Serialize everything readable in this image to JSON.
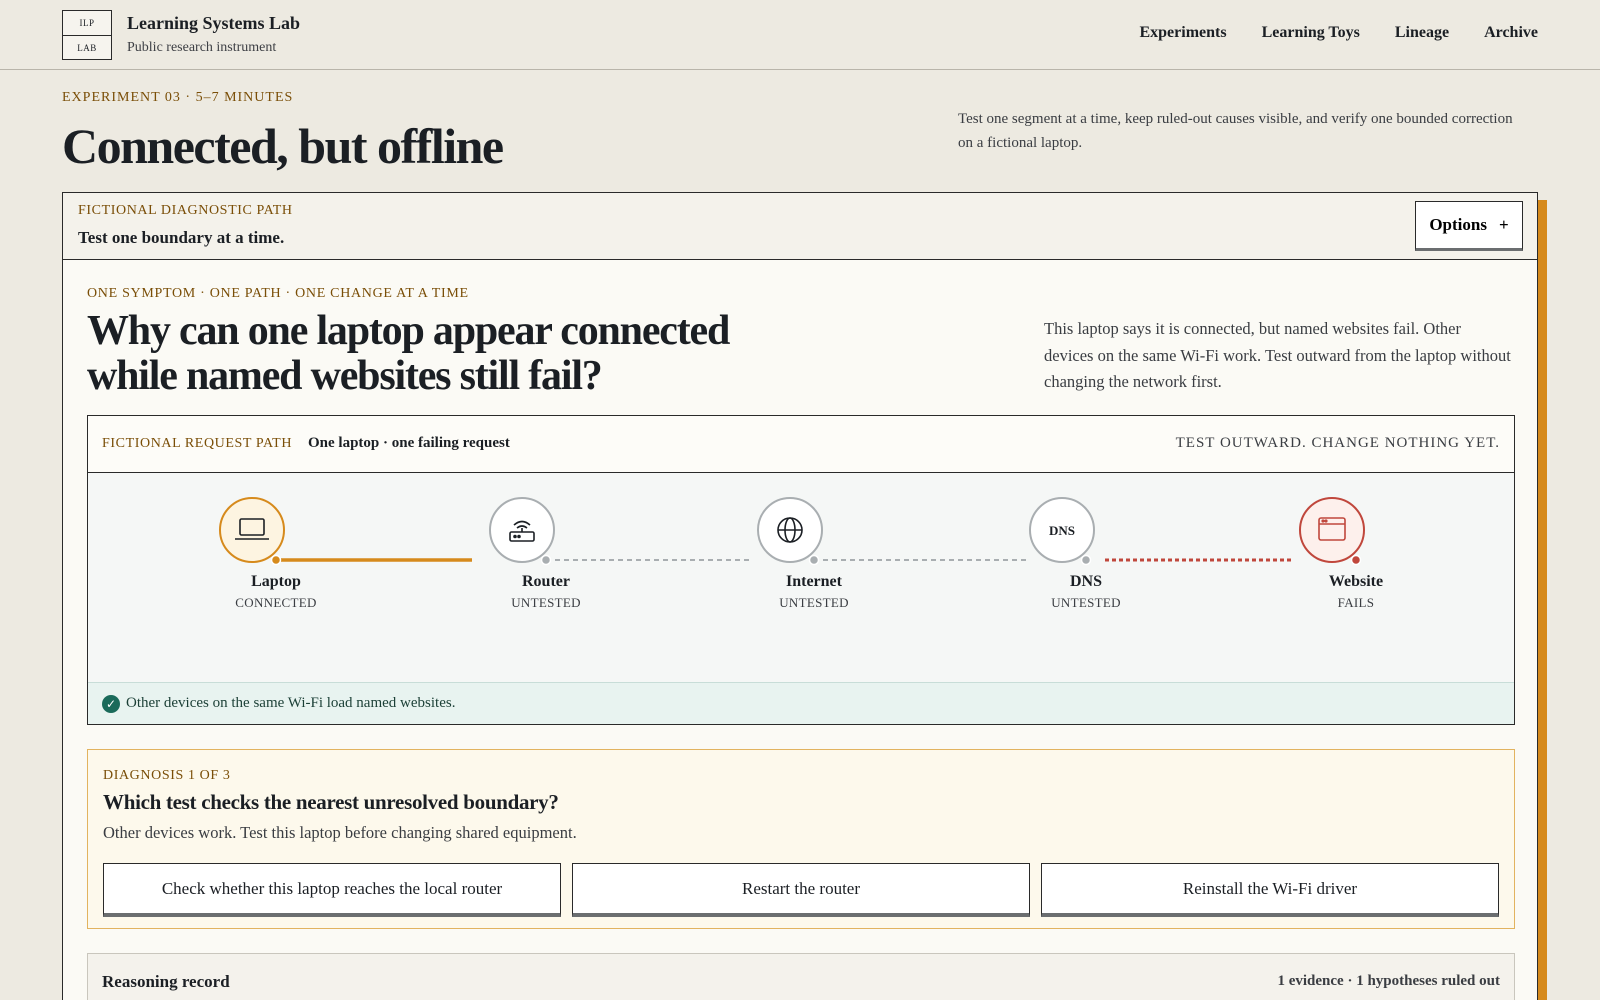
{
  "brand": {
    "logo_top": "ILP",
    "logo_bottom": "LAB",
    "name": "Learning Systems Lab",
    "subtitle": "Public research instrument"
  },
  "nav": [
    "Experiments",
    "Learning Toys",
    "Lineage",
    "Archive"
  ],
  "hero": {
    "kicker": "EXPERIMENT 03 · 5–7 MINUTES",
    "title": "Connected, but offline",
    "description": "Test one segment at a time, keep ruled-out causes visible, and verify one bounded correction on a fictional laptop."
  },
  "card": {
    "label": "FICTIONAL DIAGNOSTIC PATH",
    "heading": "Test one boundary at a time.",
    "options_label": "Options",
    "options_icon": "+",
    "sub_kicker": "ONE SYMPTOM · ONE PATH · ONE CHANGE AT A TIME",
    "question": "Why can one laptop appear connected while named websites still fail?",
    "question_desc": "This laptop says it is connected, but named websites fail. Other devices on the same Wi-Fi work. Test outward from the laptop without changing the network first."
  },
  "path": {
    "label": "FICTIONAL REQUEST PATH",
    "value": "One laptop · one failing request",
    "instruction": "TEST OUTWARD. CHANGE NOTHING YET.",
    "nodes": [
      {
        "name": "Laptop",
        "status": "CONNECTED",
        "icon": "laptop-icon",
        "state": "connected"
      },
      {
        "name": "Router",
        "status": "UNTESTED",
        "icon": "router-icon",
        "state": "untested"
      },
      {
        "name": "Internet",
        "status": "UNTESTED",
        "icon": "globe-icon",
        "state": "untested"
      },
      {
        "name": "DNS",
        "status": "UNTESTED",
        "icon": "dns-icon",
        "icon_text": "DNS",
        "state": "untested"
      },
      {
        "name": "Website",
        "status": "FAILS",
        "icon": "browser-window-icon",
        "state": "fails"
      }
    ],
    "evidence": "Other devices on the same Wi-Fi load named websites."
  },
  "colors": {
    "accent": "#d68a1c",
    "fail": "#c0473c",
    "neutral": "#a9aeb1",
    "ok": "#1a6a5a"
  },
  "diagnosis": {
    "label": "DIAGNOSIS 1 OF 3",
    "question": "Which test checks the nearest unresolved boundary?",
    "hint": "Other devices work. Test this laptop before changing shared equipment.",
    "options": [
      "Check whether this laptop reaches the local router",
      "Restart the router",
      "Reinstall the Wi-Fi driver"
    ]
  },
  "reasoning": {
    "title": "Reasoning record",
    "meta": "1 evidence · 1 hypotheses ruled out"
  }
}
